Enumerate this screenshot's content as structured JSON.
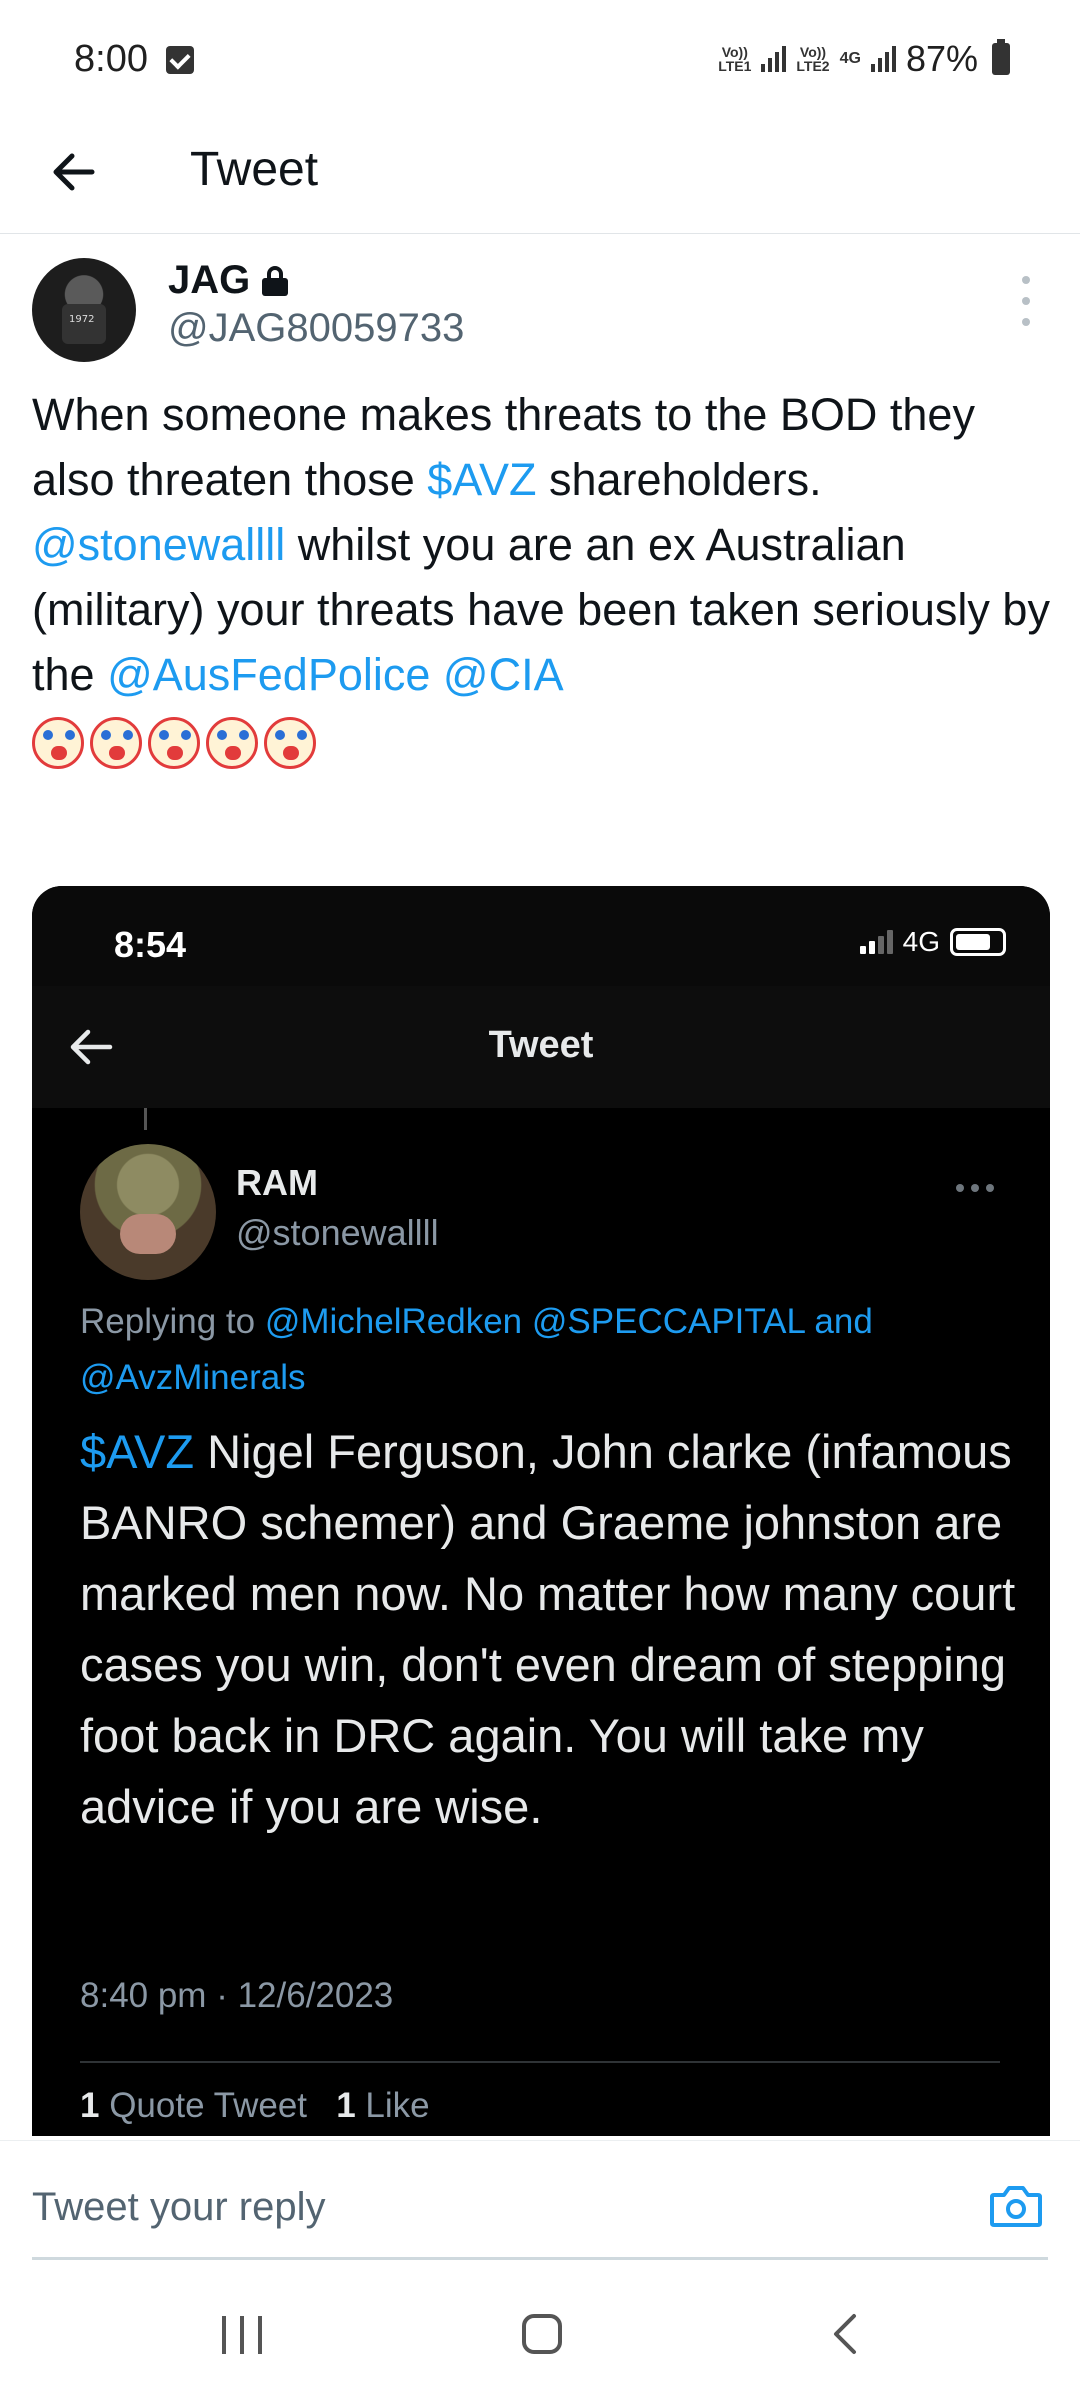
{
  "status_bar": {
    "time": "8:00",
    "sim1_label": "Vo)) LTE1",
    "sim2_label": "Vo)) LTE2",
    "network": "4G",
    "battery": "87%"
  },
  "header": {
    "title": "Tweet"
  },
  "tweet": {
    "author_name": "JAG",
    "author_handle": "@JAG80059733",
    "text_1": "When someone makes threats to the BOD they also threaten those ",
    "cashtag": "$AVZ",
    "text_2": " shareholders.",
    "mention_1": "@stonewallll",
    "text_3": " whilst you are an ex Australian (military) your threats have been taken seriously by the ",
    "mention_2": "@AusFedPolice",
    "mention_3": "@CIA"
  },
  "embedded_screenshot": {
    "status_time": "8:54",
    "status_network": "4G",
    "header_title": "Tweet",
    "author_name": "RAM",
    "author_handle": "@stonewallll",
    "replying_prefix": "Replying to ",
    "replying_1": "@MichelRedken",
    "replying_2": "@SPECCAPITAL",
    "replying_and": " and",
    "replying_3": "@AvzMinerals",
    "cashtag": "$AVZ",
    "text": " Nigel Ferguson, John clarke (infamous BANRO schemer) and Graeme johnston are marked men now. No matter how many court cases you win, don't even dream of stepping foot back in DRC  again. You will take my advice if you are wise.",
    "timestamp": "8:40 pm · 12/6/2023",
    "quote_count": "1",
    "quote_label": "Quote Tweet",
    "like_count": "1",
    "like_label": "Like"
  },
  "reply": {
    "placeholder": "Tweet your reply"
  },
  "icons": {
    "back": "arrow-left-icon",
    "lock": "lock-icon",
    "more": "more-vertical-icon",
    "camera": "camera-icon",
    "emoji": "clown-face-icon"
  },
  "colors": {
    "link": "#1d9bf0",
    "text": "#0f1419",
    "secondary": "#536471"
  }
}
